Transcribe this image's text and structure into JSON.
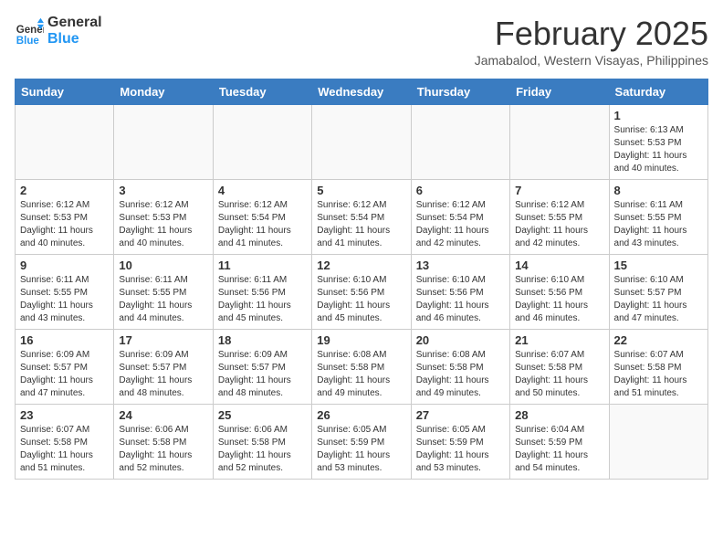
{
  "header": {
    "logo_general": "General",
    "logo_blue": "Blue",
    "month": "February 2025",
    "location": "Jamabalod, Western Visayas, Philippines"
  },
  "weekdays": [
    "Sunday",
    "Monday",
    "Tuesday",
    "Wednesday",
    "Thursday",
    "Friday",
    "Saturday"
  ],
  "weeks": [
    [
      {
        "day": "",
        "info": ""
      },
      {
        "day": "",
        "info": ""
      },
      {
        "day": "",
        "info": ""
      },
      {
        "day": "",
        "info": ""
      },
      {
        "day": "",
        "info": ""
      },
      {
        "day": "",
        "info": ""
      },
      {
        "day": "1",
        "info": "Sunrise: 6:13 AM\nSunset: 5:53 PM\nDaylight: 11 hours\nand 40 minutes."
      }
    ],
    [
      {
        "day": "2",
        "info": "Sunrise: 6:12 AM\nSunset: 5:53 PM\nDaylight: 11 hours\nand 40 minutes."
      },
      {
        "day": "3",
        "info": "Sunrise: 6:12 AM\nSunset: 5:53 PM\nDaylight: 11 hours\nand 40 minutes."
      },
      {
        "day": "4",
        "info": "Sunrise: 6:12 AM\nSunset: 5:54 PM\nDaylight: 11 hours\nand 41 minutes."
      },
      {
        "day": "5",
        "info": "Sunrise: 6:12 AM\nSunset: 5:54 PM\nDaylight: 11 hours\nand 41 minutes."
      },
      {
        "day": "6",
        "info": "Sunrise: 6:12 AM\nSunset: 5:54 PM\nDaylight: 11 hours\nand 42 minutes."
      },
      {
        "day": "7",
        "info": "Sunrise: 6:12 AM\nSunset: 5:55 PM\nDaylight: 11 hours\nand 42 minutes."
      },
      {
        "day": "8",
        "info": "Sunrise: 6:11 AM\nSunset: 5:55 PM\nDaylight: 11 hours\nand 43 minutes."
      }
    ],
    [
      {
        "day": "9",
        "info": "Sunrise: 6:11 AM\nSunset: 5:55 PM\nDaylight: 11 hours\nand 43 minutes."
      },
      {
        "day": "10",
        "info": "Sunrise: 6:11 AM\nSunset: 5:55 PM\nDaylight: 11 hours\nand 44 minutes."
      },
      {
        "day": "11",
        "info": "Sunrise: 6:11 AM\nSunset: 5:56 PM\nDaylight: 11 hours\nand 45 minutes."
      },
      {
        "day": "12",
        "info": "Sunrise: 6:10 AM\nSunset: 5:56 PM\nDaylight: 11 hours\nand 45 minutes."
      },
      {
        "day": "13",
        "info": "Sunrise: 6:10 AM\nSunset: 5:56 PM\nDaylight: 11 hours\nand 46 minutes."
      },
      {
        "day": "14",
        "info": "Sunrise: 6:10 AM\nSunset: 5:56 PM\nDaylight: 11 hours\nand 46 minutes."
      },
      {
        "day": "15",
        "info": "Sunrise: 6:10 AM\nSunset: 5:57 PM\nDaylight: 11 hours\nand 47 minutes."
      }
    ],
    [
      {
        "day": "16",
        "info": "Sunrise: 6:09 AM\nSunset: 5:57 PM\nDaylight: 11 hours\nand 47 minutes."
      },
      {
        "day": "17",
        "info": "Sunrise: 6:09 AM\nSunset: 5:57 PM\nDaylight: 11 hours\nand 48 minutes."
      },
      {
        "day": "18",
        "info": "Sunrise: 6:09 AM\nSunset: 5:57 PM\nDaylight: 11 hours\nand 48 minutes."
      },
      {
        "day": "19",
        "info": "Sunrise: 6:08 AM\nSunset: 5:58 PM\nDaylight: 11 hours\nand 49 minutes."
      },
      {
        "day": "20",
        "info": "Sunrise: 6:08 AM\nSunset: 5:58 PM\nDaylight: 11 hours\nand 49 minutes."
      },
      {
        "day": "21",
        "info": "Sunrise: 6:07 AM\nSunset: 5:58 PM\nDaylight: 11 hours\nand 50 minutes."
      },
      {
        "day": "22",
        "info": "Sunrise: 6:07 AM\nSunset: 5:58 PM\nDaylight: 11 hours\nand 51 minutes."
      }
    ],
    [
      {
        "day": "23",
        "info": "Sunrise: 6:07 AM\nSunset: 5:58 PM\nDaylight: 11 hours\nand 51 minutes."
      },
      {
        "day": "24",
        "info": "Sunrise: 6:06 AM\nSunset: 5:58 PM\nDaylight: 11 hours\nand 52 minutes."
      },
      {
        "day": "25",
        "info": "Sunrise: 6:06 AM\nSunset: 5:58 PM\nDaylight: 11 hours\nand 52 minutes."
      },
      {
        "day": "26",
        "info": "Sunrise: 6:05 AM\nSunset: 5:59 PM\nDaylight: 11 hours\nand 53 minutes."
      },
      {
        "day": "27",
        "info": "Sunrise: 6:05 AM\nSunset: 5:59 PM\nDaylight: 11 hours\nand 53 minutes."
      },
      {
        "day": "28",
        "info": "Sunrise: 6:04 AM\nSunset: 5:59 PM\nDaylight: 11 hours\nand 54 minutes."
      },
      {
        "day": "",
        "info": ""
      }
    ]
  ]
}
